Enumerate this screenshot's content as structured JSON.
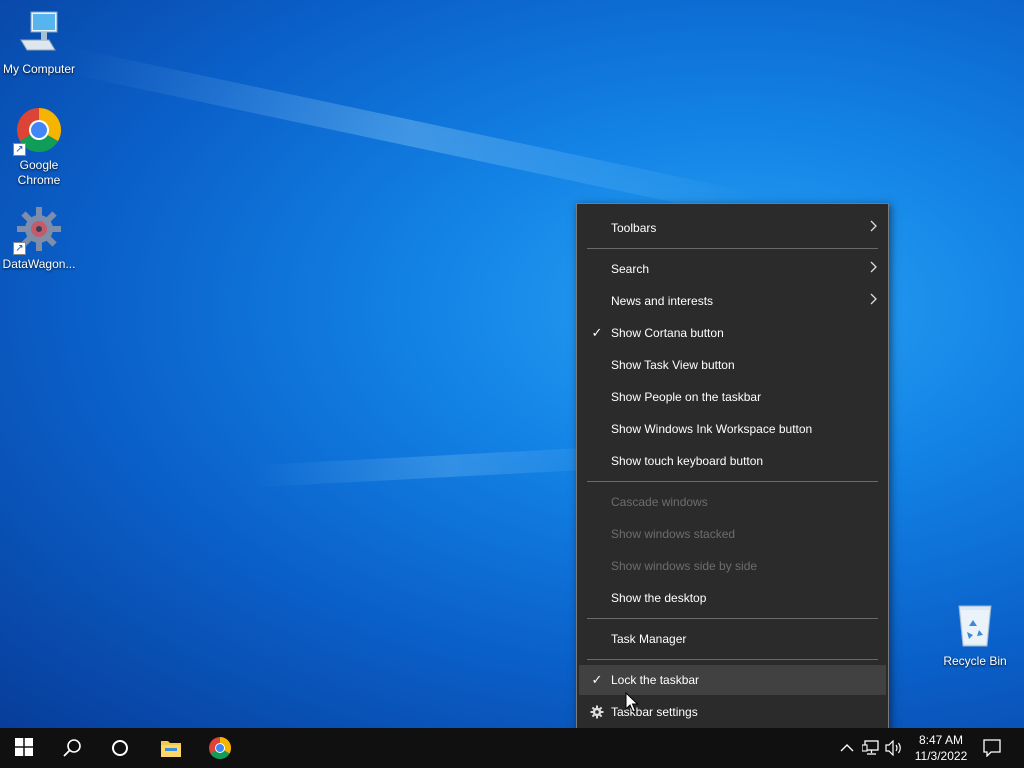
{
  "desktop_icons": [
    {
      "label": "My Computer",
      "icon": "computer-icon"
    },
    {
      "label": "Google\nChrome",
      "icon": "chrome-icon"
    },
    {
      "label": "DataWagon...",
      "icon": "datawagon-icon"
    },
    {
      "label": "Recycle Bin",
      "icon": "recycle-bin-icon"
    }
  ],
  "context_menu": {
    "items": [
      {
        "label": "Toolbars",
        "submenu": true
      },
      {
        "label": "Search",
        "submenu": true
      },
      {
        "label": "News and interests",
        "submenu": true
      },
      {
        "label": "Show Cortana button",
        "checked": true
      },
      {
        "label": "Show Task View button"
      },
      {
        "label": "Show People on the taskbar"
      },
      {
        "label": "Show Windows Ink Workspace button"
      },
      {
        "label": "Show touch keyboard button"
      },
      {
        "label": "Cascade windows",
        "disabled": true
      },
      {
        "label": "Show windows stacked",
        "disabled": true
      },
      {
        "label": "Show windows side by side",
        "disabled": true
      },
      {
        "label": "Show the desktop"
      },
      {
        "label": "Task Manager"
      },
      {
        "label": "Lock the taskbar",
        "checked": true,
        "highlighted": true
      },
      {
        "label": "Taskbar settings",
        "icon": "gear-icon"
      }
    ],
    "check_glyph": "✓",
    "chevron_glyph": "›"
  },
  "taskbar": {
    "buttons": [
      "start-icon",
      "search-icon",
      "cortana-icon",
      "file-explorer-icon",
      "chrome-icon"
    ],
    "tray_icons": [
      "chevron-up-icon",
      "network-icon",
      "volume-icon"
    ],
    "clock": {
      "time": "8:47 AM",
      "date": "11/3/2022"
    },
    "notification_icon": "notification-icon"
  },
  "colors": {
    "menu_bg": "#2b2b2b",
    "taskbar_bg": "#101010",
    "desktop_accent": "#0a60c9"
  }
}
